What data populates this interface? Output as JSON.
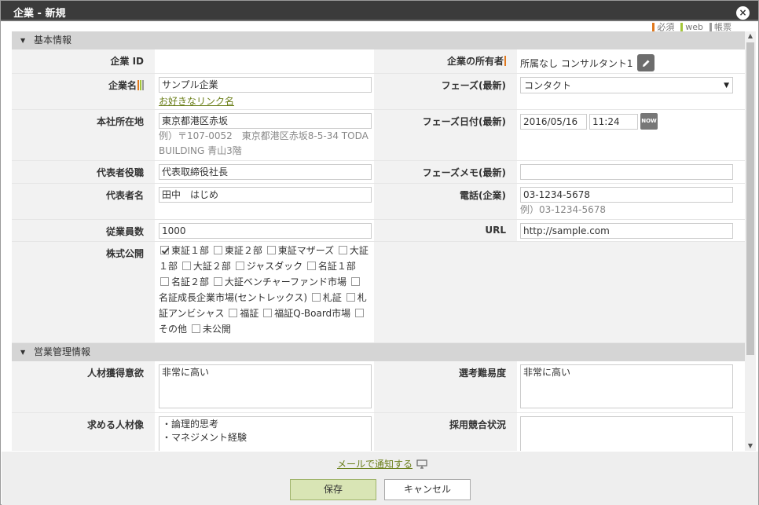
{
  "window": {
    "title": "企業 - 新規",
    "close_glyph": "×"
  },
  "legend": [
    {
      "label": "必須",
      "color": "#e0781e"
    },
    {
      "label": "web",
      "color": "#a4c639"
    },
    {
      "label": "帳票",
      "color": "#999999"
    }
  ],
  "sections": {
    "basic": "基本情報",
    "sales": "営業管理情報"
  },
  "fields": {
    "company_id": {
      "label": "企業 ID",
      "value": ""
    },
    "owner": {
      "label": "企業の所有者",
      "value": "所属なし コンサルタント1"
    },
    "company_name": {
      "label": "企業名",
      "value": "サンプル企業",
      "link": "お好きなリンク名"
    },
    "phase": {
      "label": "フェーズ(最新)",
      "value": "コンタクト"
    },
    "address": {
      "label": "本社所在地",
      "value": "東京都港区赤坂",
      "hint": "例）〒107-0052　東京都港区赤坂8-5-34 TODA BUILDING 青山3階"
    },
    "phase_date": {
      "label": "フェーズ日付(最新)",
      "date": "2016/05/16",
      "time": "11:24",
      "now": "NOW"
    },
    "rep_title": {
      "label": "代表者役職",
      "value": "代表取締役社長"
    },
    "phase_memo": {
      "label": "フェーズメモ(最新)",
      "value": ""
    },
    "rep_name": {
      "label": "代表者名",
      "value": "田中　はじめ"
    },
    "phone": {
      "label": "電話(企業)",
      "value": "03-1234-5678",
      "hint": "例）03-1234-5678"
    },
    "employees": {
      "label": "従業員数",
      "value": "1000"
    },
    "url": {
      "label": "URL",
      "value": "http://sample.com"
    },
    "listing": {
      "label": "株式公開",
      "options": [
        {
          "label": "東証１部",
          "checked": true
        },
        {
          "label": "東証２部",
          "checked": false
        },
        {
          "label": "東証マザーズ",
          "checked": false
        },
        {
          "label": "大証１部",
          "checked": false
        },
        {
          "label": "大証２部",
          "checked": false
        },
        {
          "label": "ジャスダック",
          "checked": false
        },
        {
          "label": "名証１部",
          "checked": false
        },
        {
          "label": "名証２部",
          "checked": false
        },
        {
          "label": "大証ベンチャーファンド市場",
          "checked": false
        },
        {
          "label": "名証成長企業市場(セントレックス)",
          "checked": false
        },
        {
          "label": "札証",
          "checked": false
        },
        {
          "label": "札証アンビシャス",
          "checked": false
        },
        {
          "label": "福証",
          "checked": false
        },
        {
          "label": "福証Q-Board市場",
          "checked": false
        },
        {
          "label": "その他",
          "checked": false
        },
        {
          "label": "未公開",
          "checked": false
        }
      ]
    },
    "hiring_desire": {
      "label": "人材獲得意欲",
      "value": "非常に高い"
    },
    "selection_difficulty": {
      "label": "選考難易度",
      "value": "非常に高い"
    },
    "desired_talent": {
      "label": "求める人材像",
      "value": "・論理的思考\n・マネジメント経験"
    },
    "competition": {
      "label": "採用競合状況",
      "value": ""
    }
  },
  "footer": {
    "mail_link": "メールで通知する",
    "save": "保存",
    "cancel": "キャンセル"
  }
}
